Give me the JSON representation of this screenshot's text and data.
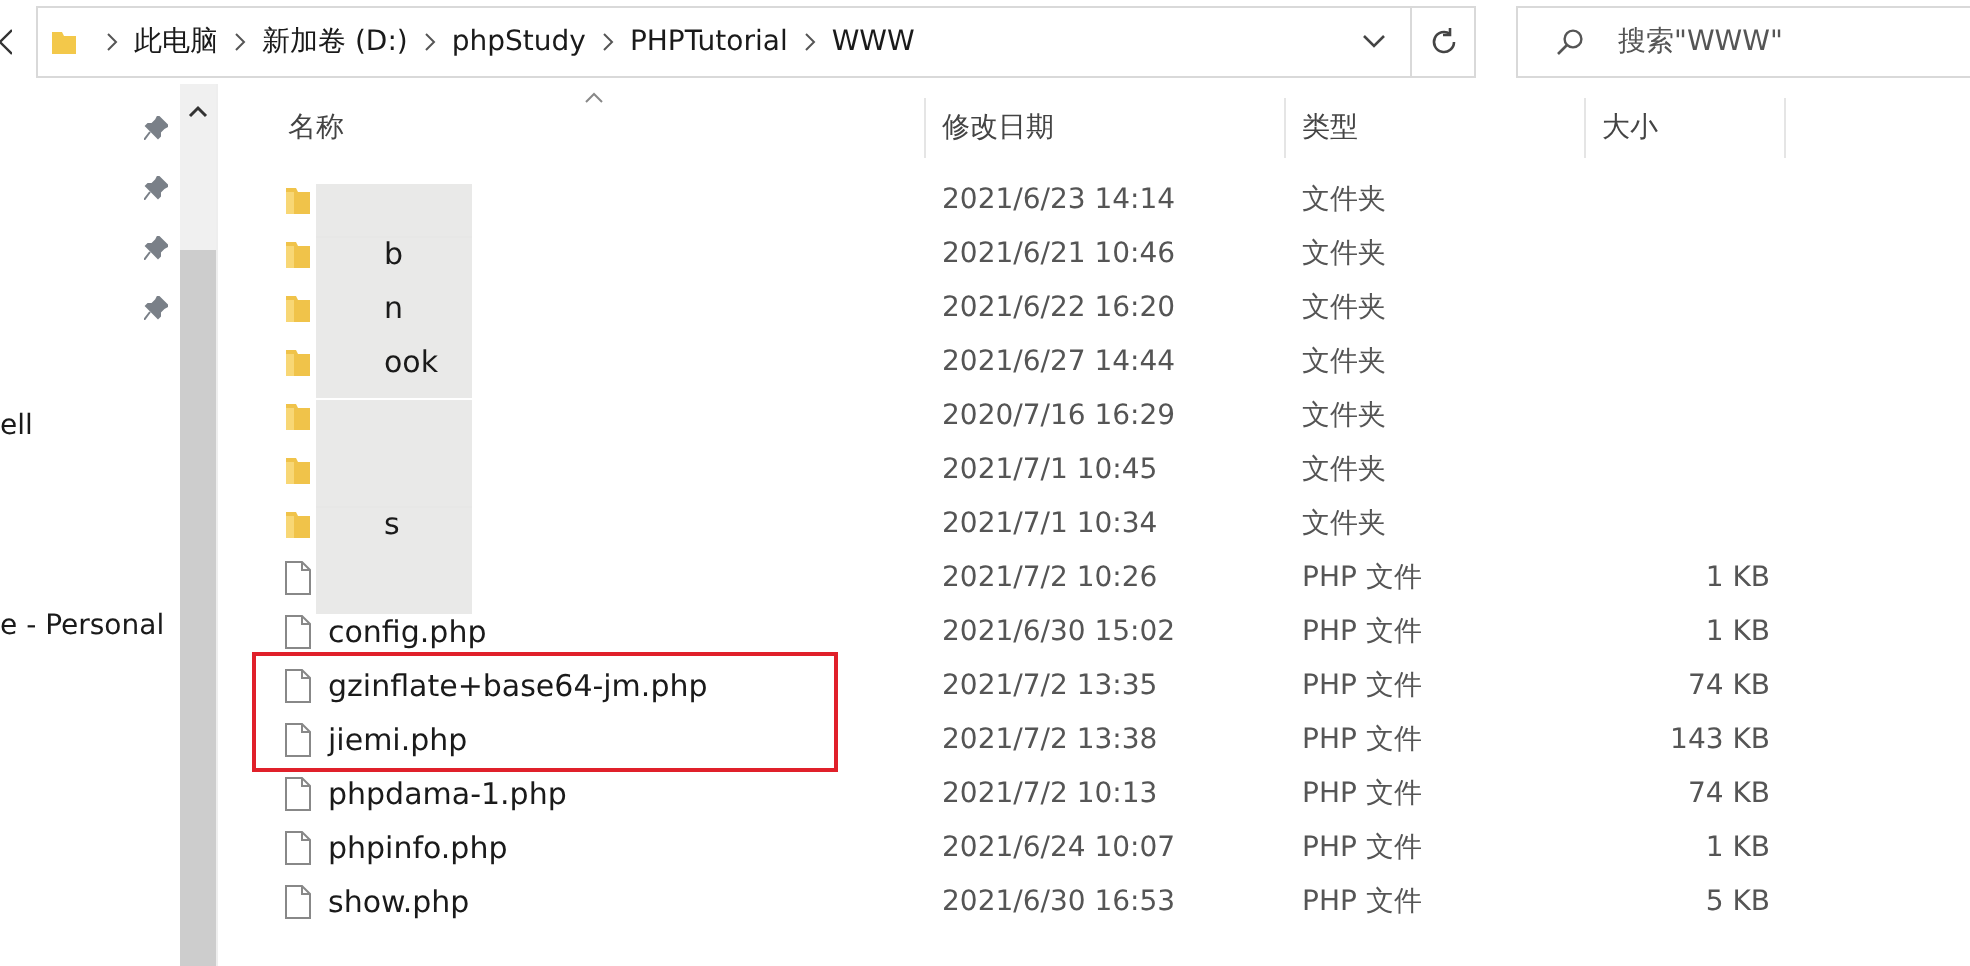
{
  "address_bar": {
    "path": [
      "此电脑",
      "新加卷 (D:)",
      "phpStudy",
      "PHPTutorial",
      "WWW"
    ]
  },
  "search": {
    "placeholder": "搜索\"WWW\""
  },
  "navigation_pane": {
    "items": [
      {
        "label": "ell"
      },
      {
        "label": "e - Personal"
      }
    ]
  },
  "file_list": {
    "columns": [
      "名称",
      "修改日期",
      "类型",
      "大小"
    ],
    "rows": [
      {
        "kind": "folder",
        "redacted": true,
        "date": "2021/6/23 14:14",
        "type": "文件夹",
        "marked": false
      },
      {
        "kind": "folder",
        "name": "b",
        "redacted": true,
        "date": "2021/6/21 10:46",
        "type": "文件夹",
        "marked": false
      },
      {
        "kind": "folder",
        "name": "n",
        "redacted": true,
        "date": "2021/6/22 16:20",
        "type": "文件夹",
        "marked": false
      },
      {
        "kind": "folder",
        "name": "ook",
        "redacted": true,
        "date": "2021/6/27 14:44",
        "type": "文件夹",
        "marked": false
      },
      {
        "kind": "folder",
        "redacted": true,
        "date": "2020/7/16 16:29",
        "type": "文件夹",
        "marked": false
      },
      {
        "kind": "folder",
        "redacted": true,
        "date": "2021/7/1 10:45",
        "type": "文件夹",
        "marked": false
      },
      {
        "kind": "folder",
        "name": "s",
        "redacted": true,
        "date": "2021/7/1 10:34",
        "type": "文件夹",
        "marked": false
      },
      {
        "kind": "file",
        "redacted": true,
        "date": "2021/7/2 10:26",
        "type": "PHP 文件",
        "size": "1 KB",
        "marked": false
      },
      {
        "kind": "file",
        "name": "config.php",
        "redacted": false,
        "date": "2021/6/30 15:02",
        "type": "PHP 文件",
        "size": "1 KB",
        "marked": false
      },
      {
        "kind": "file",
        "name": "gzinflate+base64-jm.php",
        "redacted": false,
        "date": "2021/7/2 13:35",
        "type": "PHP 文件",
        "size": "74 KB",
        "marked": true
      },
      {
        "kind": "file",
        "name": "jiemi.php",
        "redacted": false,
        "date": "2021/7/2 13:38",
        "type": "PHP 文件",
        "size": "143 KB",
        "marked": true
      },
      {
        "kind": "file",
        "name": "phpdama-1.php",
        "redacted": false,
        "date": "2021/7/2 10:13",
        "type": "PHP 文件",
        "size": "74 KB",
        "marked": false
      },
      {
        "kind": "file",
        "name": "phpinfo.php",
        "redacted": false,
        "date": "2021/6/24 10:07",
        "type": "PHP 文件",
        "size": "1 KB",
        "marked": false
      },
      {
        "kind": "file",
        "name": "show.php",
        "redacted": false,
        "date": "2021/6/30 16:53",
        "type": "PHP 文件",
        "size": "5 KB",
        "marked": false
      }
    ]
  }
}
